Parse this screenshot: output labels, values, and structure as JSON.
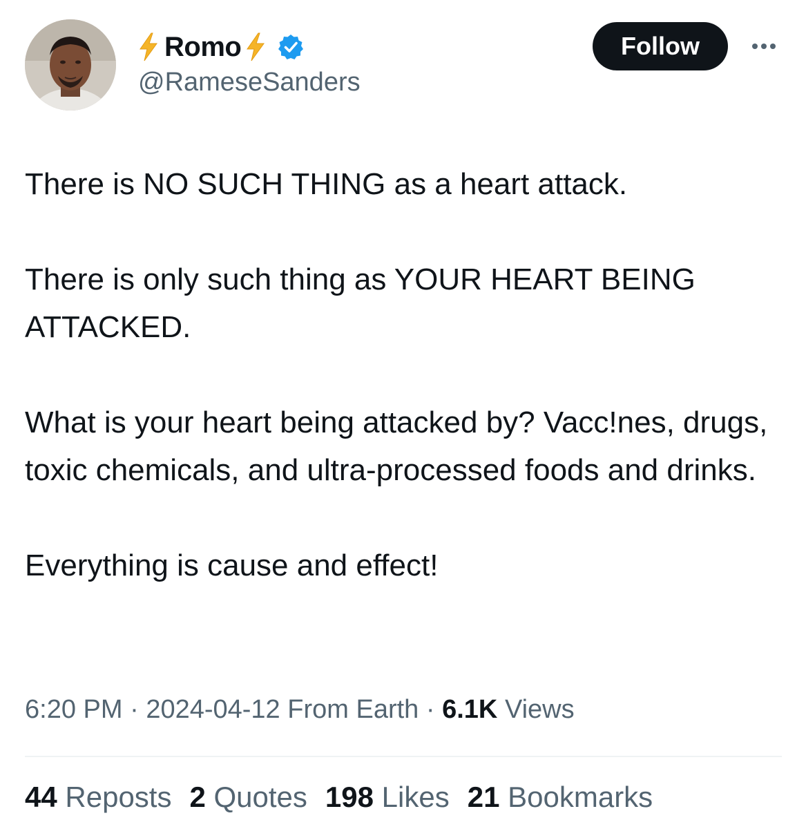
{
  "author": {
    "display_name": "Romo",
    "handle": "@RameseSanders",
    "verified": true,
    "name_emoji": "lightning-bolt",
    "accent_color": "#f5b428",
    "verified_color": "#1d9bf0"
  },
  "actions": {
    "follow_label": "Follow"
  },
  "tweet": {
    "paragraphs": [
      "There is NO SUCH THING as a heart attack.",
      "There is only such thing as YOUR HEART BEING ATTACKED.",
      "What is your heart being attacked by? Vacc!nes, drugs, toxic chemicals, and ultra-processed foods and drinks.",
      "Everything is cause and effect!"
    ]
  },
  "meta": {
    "time": "6:20 PM",
    "separator": "·",
    "date": "2024-04-12",
    "source": "From Earth",
    "views_count": "6.1K",
    "views_label": "Views"
  },
  "stats": {
    "reposts_count": "44",
    "reposts_label": "Reposts",
    "quotes_count": "2",
    "quotes_label": "Quotes",
    "likes_count": "198",
    "likes_label": "Likes",
    "bookmarks_count": "21",
    "bookmarks_label": "Bookmarks"
  }
}
